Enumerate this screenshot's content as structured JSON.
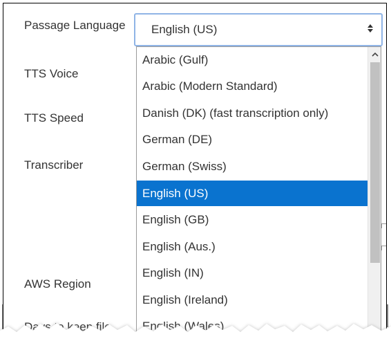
{
  "settings": {
    "passage_language": {
      "label": "Passage Language",
      "value": "English (US)"
    },
    "tts_voice": {
      "label": "TTS Voice"
    },
    "tts_speed": {
      "label": "TTS Speed"
    },
    "transcriber": {
      "label": "Transcriber"
    },
    "aws_region": {
      "label": "AWS Region"
    },
    "days_to_keep_file": {
      "label": "Days to keep file"
    }
  },
  "dropdown": {
    "options": [
      "Arabic (Gulf)",
      "Arabic (Modern Standard)",
      "Danish (DK) (fast transcription only)",
      "German (DE)",
      "German (Swiss)",
      "English (US)",
      "English (GB)",
      "English (Aus.)",
      "English (IN)",
      "English (Ireland)",
      "English (Wales)"
    ],
    "selected": "English (US)"
  },
  "icons": {
    "select_arrows": "up-down-arrows-icon",
    "scroll_up": "chevron-up-icon"
  },
  "colors": {
    "selected_bg": "#0a73cf",
    "focus_border": "#8fb4e6",
    "scrollbar_thumb": "#c1c1c1"
  }
}
